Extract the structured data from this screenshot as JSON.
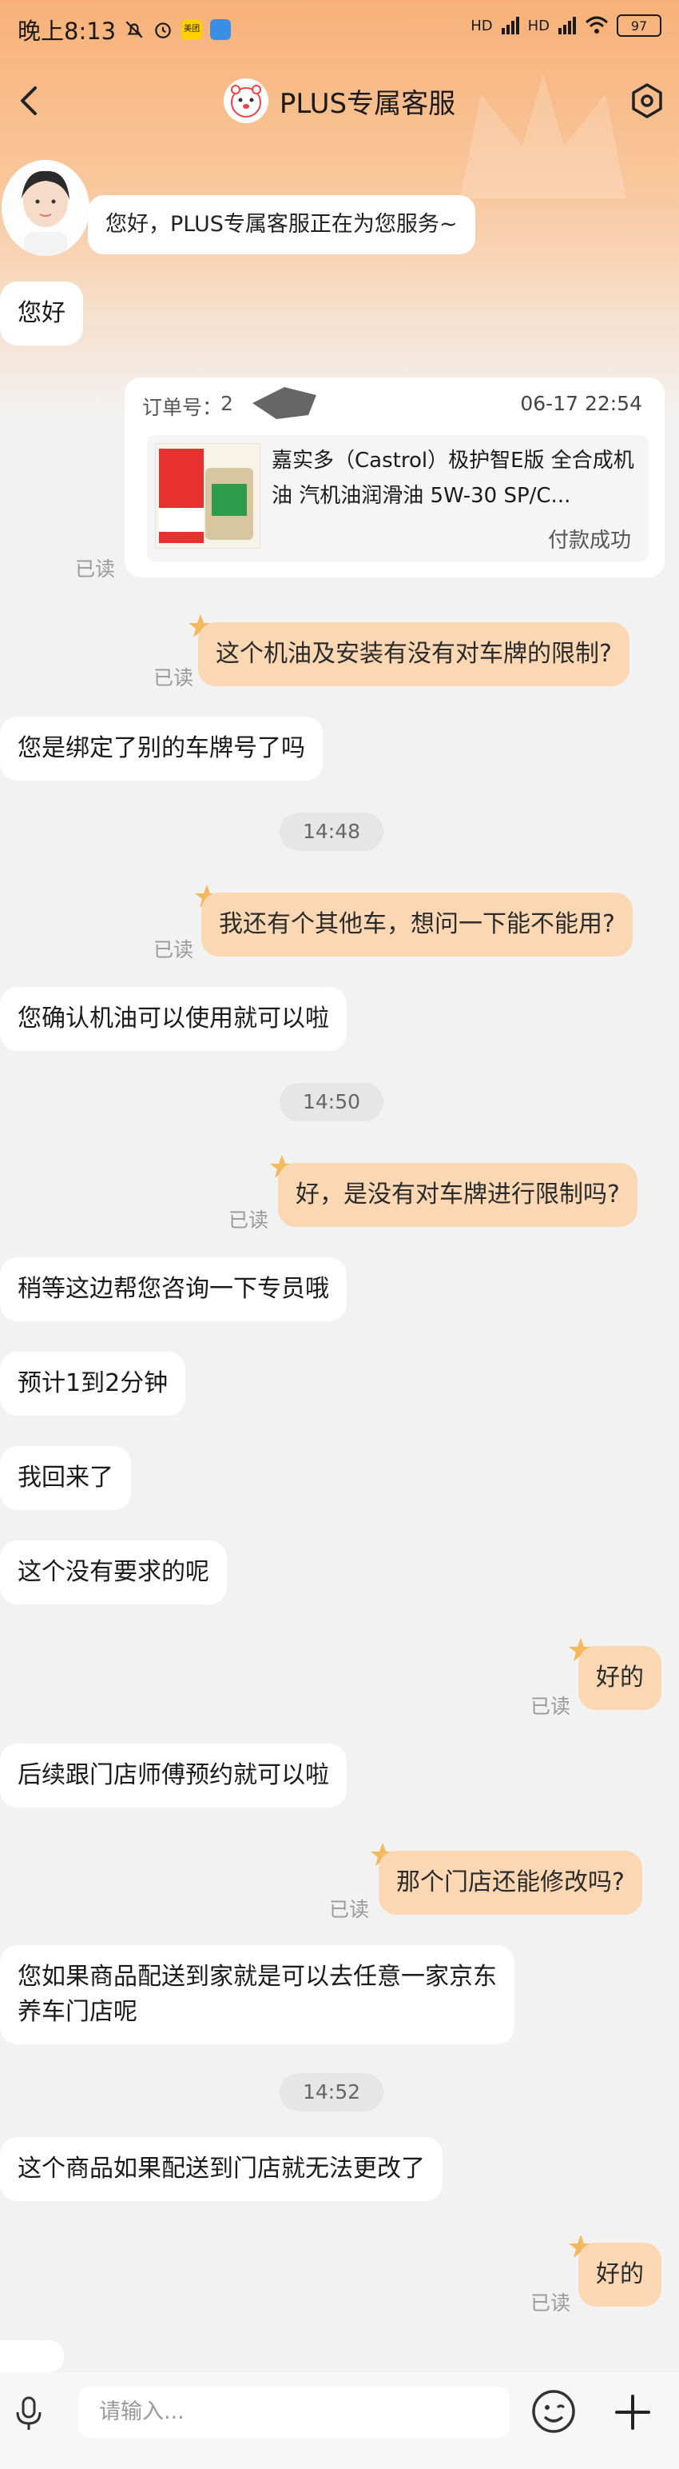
{
  "status_bar": {
    "time": "晚上8:13",
    "net_label": "美团",
    "signal1": "HD",
    "signal2": "HD",
    "battery": "97"
  },
  "header": {
    "title": "PLUS专属客服"
  },
  "greeting": "您好，PLUS专属客服正在为您服务~",
  "order": {
    "label": "订单号：",
    "number": "2",
    "date": "06-17 22:54",
    "product_name": "嘉实多（Castrol）极护智E版 全合成机油 汽机油润滑油 5W-30 SP/C...",
    "status": "付款成功"
  },
  "messages": [
    {
      "side": "left",
      "text": "您好"
    },
    {
      "side": "right",
      "text": "这个机油及安装有没有对车牌的限制?",
      "read": "已读"
    },
    {
      "side": "left",
      "text": "您是绑定了别的车牌号了吗"
    },
    {
      "time": "14:48"
    },
    {
      "side": "right",
      "text": "我还有个其他车，想问一下能不能用?",
      "read": "已读"
    },
    {
      "side": "left",
      "text": "您确认机油可以使用就可以啦"
    },
    {
      "time": "14:50"
    },
    {
      "side": "right",
      "text": "好，是没有对车牌进行限制吗?",
      "read": "已读"
    },
    {
      "side": "left",
      "text": "稍等这边帮您咨询一下专员哦"
    },
    {
      "side": "left",
      "text": "预计1到2分钟"
    },
    {
      "side": "left",
      "text": "我回来了"
    },
    {
      "side": "left",
      "text": "这个没有要求的呢"
    },
    {
      "side": "right",
      "text": "好的",
      "read": "已读"
    },
    {
      "side": "left",
      "text": "后续跟门店师傅预约就可以啦"
    },
    {
      "side": "right",
      "text": "那个门店还能修改吗?",
      "read": "已读"
    },
    {
      "side": "left",
      "line1": "您如果商品配送到家就是可以去任意一家京东",
      "line2": "养车门店呢"
    },
    {
      "time": "14:52"
    },
    {
      "side": "left",
      "text": "这个商品如果配送到门店就无法更改了"
    },
    {
      "side": "right",
      "text": "好的",
      "read": "已读"
    }
  ],
  "order_read": "已读",
  "input": {
    "placeholder": "请输入..."
  },
  "colors": {
    "accent": "#f7b178",
    "bubble_right": "#fbd8b3",
    "bubble_left": "#ffffff",
    "background": "#f2f2f2"
  }
}
